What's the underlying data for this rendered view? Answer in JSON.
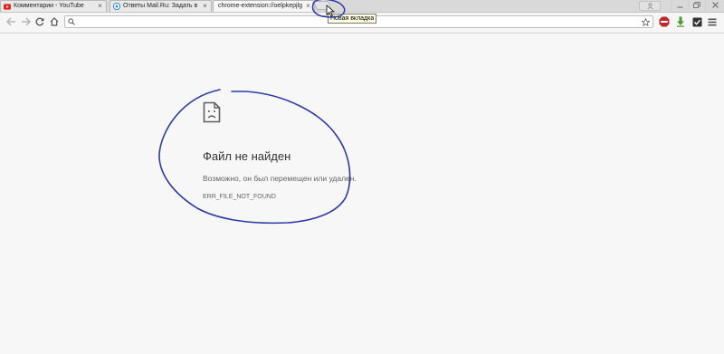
{
  "browser": {
    "tabs": [
      {
        "title": "Комментарии - YouTube",
        "favicon": "youtube-icon",
        "active": false
      },
      {
        "title": "Ответы Mail.Ru: Задать в",
        "favicon": "mailru-answers-icon",
        "active": false
      },
      {
        "title": "chrome-extension://oelpkepjlg",
        "favicon": "none",
        "active": true
      }
    ],
    "new_tab_tooltip": "Новая вкладка",
    "close_tab_symbol": "×"
  },
  "toolbar": {
    "address_value": "",
    "address_placeholder": "",
    "extensions": [
      "adblock-icon",
      "download-arrow-icon",
      "extension-checkbox-icon",
      "chrome-menu-icon"
    ]
  },
  "error": {
    "title": "Файл не найден",
    "message": "Возможно, он был перемещен или удален.",
    "code": "ERR_FILE_NOT_FOUND"
  },
  "colors": {
    "annotation": "#2b3aa8",
    "youtube": "#e62117",
    "adblock": "#c0272d",
    "download": "#4a9a2e"
  }
}
